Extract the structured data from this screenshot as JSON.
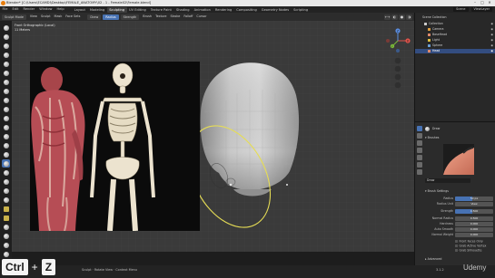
{
  "titlebar": {
    "title": "Blender* [C:\\Users\\ECAMDI\\Desktop\\FEMALE_ANATOMY\\02 - 1 - Female02\\Female.blend]",
    "min": "–",
    "max": "□",
    "close": "✕"
  },
  "menubar": {
    "menus": [
      "File",
      "Edit",
      "Render",
      "Window",
      "Help"
    ],
    "workspaces": [
      "Layout",
      "Modeling",
      "Sculpting",
      "UV Editing",
      "Texture Paint",
      "Shading",
      "Animation",
      "Rendering",
      "Compositing",
      "Geometry Nodes",
      "Scripting"
    ],
    "active_workspace": "Sculpting",
    "scene": "Scene",
    "view_layer": "ViewLayer"
  },
  "headerbar": {
    "mode": "Sculpt Mode",
    "menus": [
      "View",
      "Sculpt",
      "Mask",
      "Face Sets"
    ],
    "brush": "Draw",
    "props": [
      "Radius",
      "Strength",
      "Brush",
      "Texture",
      "Stroke",
      "Falloff",
      "Cursor"
    ]
  },
  "viewport": {
    "view_name": "Front Orthographic (Local)",
    "units": "11 Meters",
    "axes": {
      "x": "X",
      "y": "Y",
      "z": "Z"
    }
  },
  "outliner": {
    "header": "Scene Collection",
    "items": [
      {
        "label": "Collection",
        "color": "#cccccc"
      },
      {
        "label": "Camera",
        "color": "#e0a040"
      },
      {
        "label": "BaseHead",
        "color": "#e08a6a"
      },
      {
        "label": "Light",
        "color": "#e0c040"
      },
      {
        "label": "Sphere",
        "color": "#6a9fd8"
      },
      {
        "label": "Head",
        "color": "#e08a6a"
      }
    ],
    "selected_index": 5
  },
  "properties": {
    "tool_name": "Draw",
    "brushes_label": "Brushes",
    "texture_label": "Draw",
    "brush_settings_label": "Brush Settings",
    "rows": [
      {
        "label": "Radius",
        "value": "50 px"
      },
      {
        "label": "Radius Unit",
        "value": "View"
      },
      {
        "label": "Strength",
        "value": "0.500"
      },
      {
        "label": "Normal Radius",
        "value": "0.500"
      },
      {
        "label": "Hardness",
        "value": "0.000"
      },
      {
        "label": "Auto Smooth",
        "value": "0.000"
      },
      {
        "label": "Normal Weight",
        "value": "0.000"
      }
    ],
    "checks": [
      "Front Faces Only",
      "Grab Active Vertex",
      "Grab Silhouette"
    ],
    "advanced_label": "Advanced"
  },
  "statusbar": {
    "hint": "Sculpt · Rotate View · Context Menu",
    "version": "3.1.2"
  },
  "key_overlay": {
    "key1": "Ctrl",
    "plus": "+",
    "key2": "Z"
  },
  "watermark": "Udemy"
}
